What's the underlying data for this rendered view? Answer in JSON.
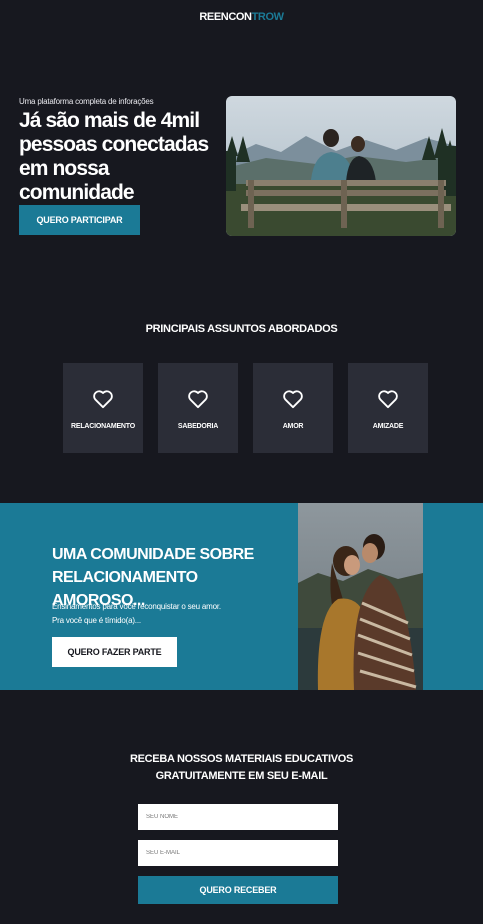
{
  "header": {
    "logo_part1": "REENCON",
    "logo_part2": "TROW"
  },
  "hero": {
    "kicker": "Uma plataforma completa de inforações",
    "title": "Já são mais de 4mil pessoas conectadas em nossa comunidade",
    "cta": "QUERO PARTICIPAR"
  },
  "topics": {
    "title": "PRINCIPAIS ASSUNTOS ABORDADOS",
    "items": [
      {
        "label": "RELACIONAMENTO",
        "icon": "heart-icon"
      },
      {
        "label": "SABEDORIA",
        "icon": "heart-icon"
      },
      {
        "label": "AMOR",
        "icon": "heart-icon"
      },
      {
        "label": "AMIZADE",
        "icon": "heart-icon"
      }
    ]
  },
  "community": {
    "title": "UMA COMUNIDADE SOBRE RELACIONAMENTO AMOROSO...",
    "line1": "Ensinamentos para você reconquistar o seu amor.",
    "line2": "Pra você que é tímido(a)...",
    "cta": "QUERO FAZER PARTE"
  },
  "newsletter": {
    "title_line1": "RECEBA NOSSOS MATERIAIS EDUCATIVOS",
    "title_line2": "GRATUITAMENTE EM SEU E-MAIL",
    "name_placeholder": "SEU NOME",
    "email_placeholder": "SEU E-MAIL",
    "submit": "QUERO RECEBER"
  },
  "colors": {
    "background": "#17181f",
    "accent": "#1b7a96",
    "card": "#2b2d37"
  }
}
